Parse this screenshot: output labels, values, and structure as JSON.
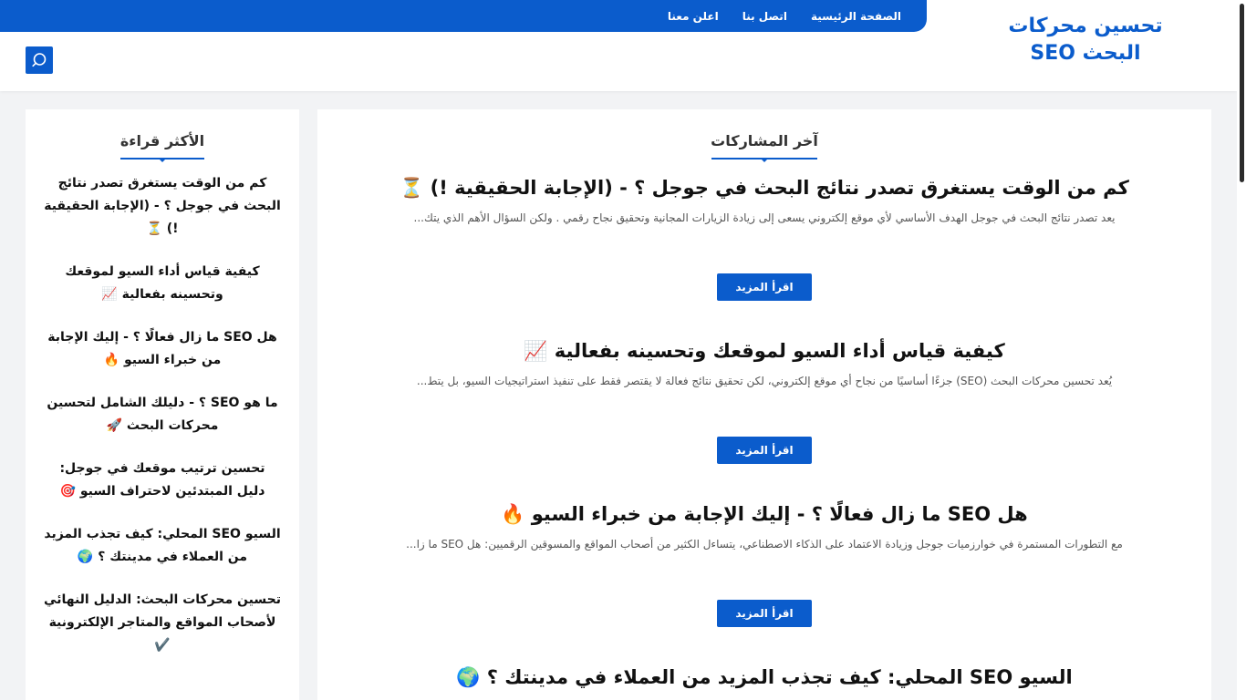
{
  "header": {
    "site_title": "تحسين محركات البحث SEO",
    "nav": [
      "الصفحة الرئيسية",
      "اتصل بنا",
      "اعلن معنا"
    ]
  },
  "colors": {
    "brand": "#0b5ccc",
    "page_bg": "#f2f3f5"
  },
  "main": {
    "section_title": "آخر المشاركات",
    "posts": [
      {
        "title": "كم من الوقت يستغرق تصدر نتائج البحث في جوجل ؟ - (الإجابة الحقيقية !) ⏳",
        "excerpt": "يعد تصدر نتائج البحث في جوجل الهدف الأساسي لأي موقع إلكتروني يسعى إلى زيادة الزيارات المجانية وتحقيق نجاح رقمي . ولكن السؤال الأهم الذي يتك...",
        "read_more": "اقرأ المزيد"
      },
      {
        "title": "كيفية قياس أداء السيو لموقعك وتحسينه بفعالية 📈",
        "excerpt": "يُعد تحسين محركات البحث (SEO) جزءًا أساسيًا من نجاح أي موقع إلكتروني، لكن تحقيق نتائج فعالة لا يقتصر فقط على تنفيذ استراتيجيات السيو، بل يتط...",
        "read_more": "اقرأ المزيد"
      },
      {
        "title": "هل SEO ما زال فعالًا ؟ - إليك الإجابة من خبراء السيو 🔥",
        "excerpt": "مع التطورات المستمرة في خوارزميات جوجل وزيادة الاعتماد على الذكاء الاصطناعي، يتساءل الكثير من أصحاب المواقع والمسوقين الرقميين: هل SEO ما زا...",
        "read_more": "اقرأ المزيد"
      },
      {
        "title": "السيو SEO المحلي: كيف تجذب المزيد من العملاء في مدينتك ؟ 🌍",
        "excerpt": "",
        "read_more": ""
      }
    ]
  },
  "sidebar": {
    "section_title": "الأكثر قراءة",
    "items": [
      "كم من الوقت يستغرق تصدر نتائج البحث في جوجل ؟ - (الإجابة الحقيقية !) ⏳",
      "كيفية قياس أداء السيو لموقعك وتحسينه بفعالية 📈",
      "هل SEO ما زال فعالًا ؟ - إليك الإجابة من خبراء السيو 🔥",
      "ما هو SEO ؟ - دليلك الشامل لتحسين محركات البحث 🚀",
      "تحسين ترتيب موقعك في جوجل: دليل المبتدئين لاحتراف السيو 🎯",
      "السيو SEO المحلي: كيف تجذب المزيد من العملاء في مدينتك ؟ 🌍",
      "تحسين محركات البحث: الدليل النهائي لأصحاب المواقع والمتاجر الإلكترونية ✔️"
    ]
  }
}
